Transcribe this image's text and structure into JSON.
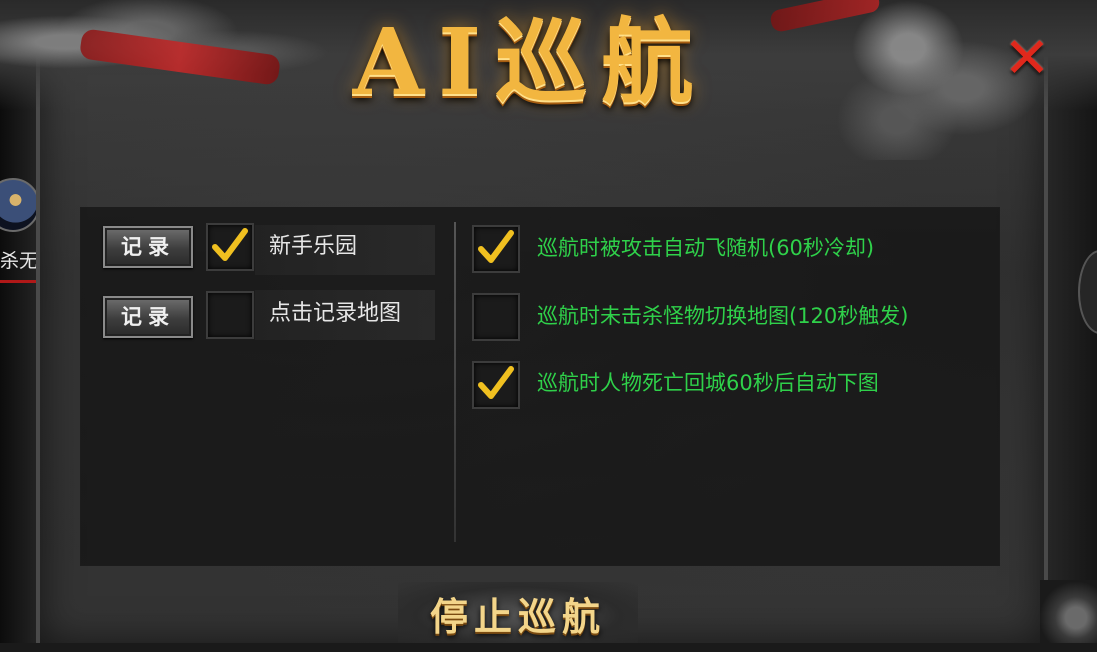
{
  "window": {
    "title": "AI巡航",
    "close_symbol": "✕"
  },
  "side": {
    "player_name": "杀无"
  },
  "left_list": [
    {
      "button_label": "记录",
      "checked": true,
      "map_name": "新手乐园"
    },
    {
      "button_label": "记录",
      "checked": false,
      "map_name": "点击记录地图"
    }
  ],
  "options": [
    {
      "label": "巡航时被攻击自动飞随机(60秒冷却)",
      "checked": true
    },
    {
      "label": "巡航时未击杀怪物切换地图(120秒触发)",
      "checked": false
    },
    {
      "label": "巡航时人物死亡回城60秒后自动下图",
      "checked": true
    }
  ],
  "footer": {
    "stop_label": "停止巡航"
  },
  "colors": {
    "option_text": "#2fd14a",
    "title": "#f2b640",
    "close": "#e0281c",
    "check": "#f0c020"
  }
}
